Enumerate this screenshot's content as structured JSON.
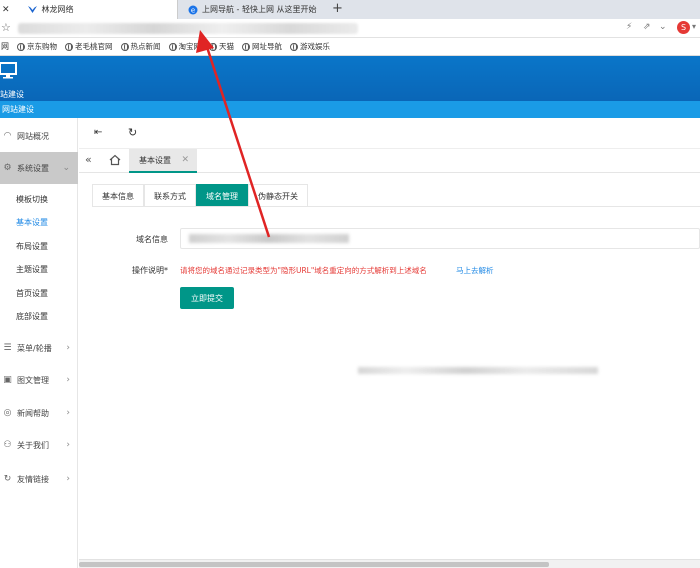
{
  "browser": {
    "tabs": [
      {
        "title": "林龙网络"
      },
      {
        "title": "上网导航 - 轻快上网 从这里开始"
      }
    ],
    "new_tab_label": "+",
    "bookmarks": [
      "京东购物",
      "老毛桃官网",
      "热点新闻",
      "淘宝网",
      "天猫",
      "网址导航",
      "游戏娱乐"
    ]
  },
  "header": {
    "logo_text": "站建设",
    "sub_text": "网站建设"
  },
  "sidebar": {
    "items": [
      {
        "label": "网站概况",
        "icon": "speedometer-icon"
      },
      {
        "label": "系统设置",
        "icon": "gear-icon"
      },
      {
        "label": "菜单/轮播",
        "icon": "list-icon"
      },
      {
        "label": "图文管理",
        "icon": "image-icon"
      },
      {
        "label": "新闻帮助",
        "icon": "help-icon"
      },
      {
        "label": "关于我们",
        "icon": "users-icon"
      },
      {
        "label": "友情链接",
        "icon": "link-icon"
      }
    ],
    "sub_items": [
      "模板切换",
      "基本设置",
      "布局设置",
      "主题设置",
      "首页设置",
      "底部设置"
    ],
    "active_sub": "基本设置"
  },
  "breadcrumb": {
    "tab": "基本设置"
  },
  "tabs": [
    "基本信息",
    "联系方式",
    "域名管理",
    "伪静态开关"
  ],
  "active_tab": "域名管理",
  "form": {
    "domain_label": "域名信息",
    "help_label": "操作说明*",
    "help_text": "请将您的域名通过记录类型为\"隐形URL\"域名重定向的方式解析到上述域名",
    "help_link": "马上去解析",
    "submit_label": "立即提交"
  },
  "colors": {
    "header_blue": "#0a6cbd",
    "subheader_blue": "#1a9be6",
    "accent_teal": "#009688",
    "warning_red": "#e53935",
    "link_blue": "#1e88e5",
    "annotation_arrow": "#e02424"
  }
}
